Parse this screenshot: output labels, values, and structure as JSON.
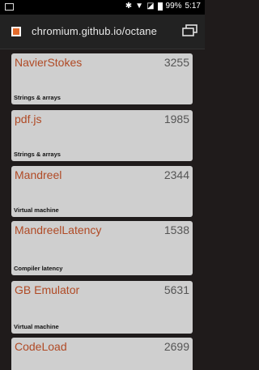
{
  "status_bar": {
    "battery_percent": "99%",
    "time": "5:17",
    "icons": [
      "bluetooth-icon",
      "wifi-icon",
      "no-signal-icon",
      "battery-icon"
    ]
  },
  "browser": {
    "url": "chromium.github.io/octane",
    "site_icon": "octane-favicon",
    "tabs_icon": "tab-switcher-icon"
  },
  "benchmarks": [
    {
      "name": "NavierStokes",
      "score": "3255",
      "category": "Strings & arrays"
    },
    {
      "name": "pdf.js",
      "score": "1985",
      "category": "Strings & arrays"
    },
    {
      "name": "Mandreel",
      "score": "2344",
      "category": "Virtual machine"
    },
    {
      "name": "MandreelLatency",
      "score": "1538",
      "category": "Compiler latency"
    },
    {
      "name": "GB Emulator",
      "score": "5631",
      "category": "Virtual machine"
    },
    {
      "name": "CodeLoad",
      "score": "2699",
      "category": ""
    }
  ],
  "colors": {
    "card_bg": "#cfcfcf",
    "name_color": "#b04a25",
    "page_bg": "#1f1b1b"
  }
}
